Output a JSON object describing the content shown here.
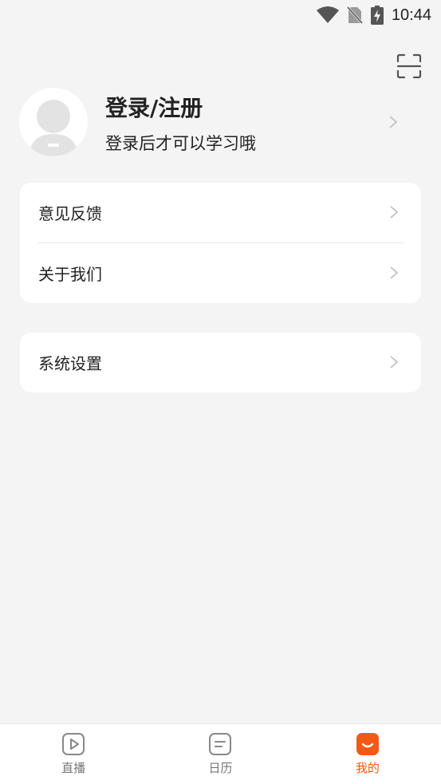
{
  "status_bar": {
    "time": "10:44",
    "icons": [
      "wifi-icon",
      "no-sim-icon",
      "battery-charging-icon"
    ]
  },
  "header": {
    "scan_icon": "scan-icon"
  },
  "profile": {
    "title": "登录/注册",
    "subtitle": "登录后才可以学习哦",
    "avatar_icon": "default-avatar-icon"
  },
  "menu_group_1": {
    "items": [
      {
        "label": "意见反馈"
      },
      {
        "label": "关于我们"
      }
    ]
  },
  "menu_group_2": {
    "items": [
      {
        "label": "系统设置"
      }
    ]
  },
  "tab_bar": {
    "tabs": [
      {
        "label": "直播",
        "icon": "live-play-icon",
        "active": false
      },
      {
        "label": "日历",
        "icon": "calendar-icon",
        "active": false
      },
      {
        "label": "我的",
        "icon": "mine-smile-icon",
        "active": true
      }
    ]
  },
  "colors": {
    "accent": "#f25a14",
    "background": "#f4f4f4",
    "card": "#ffffff"
  }
}
